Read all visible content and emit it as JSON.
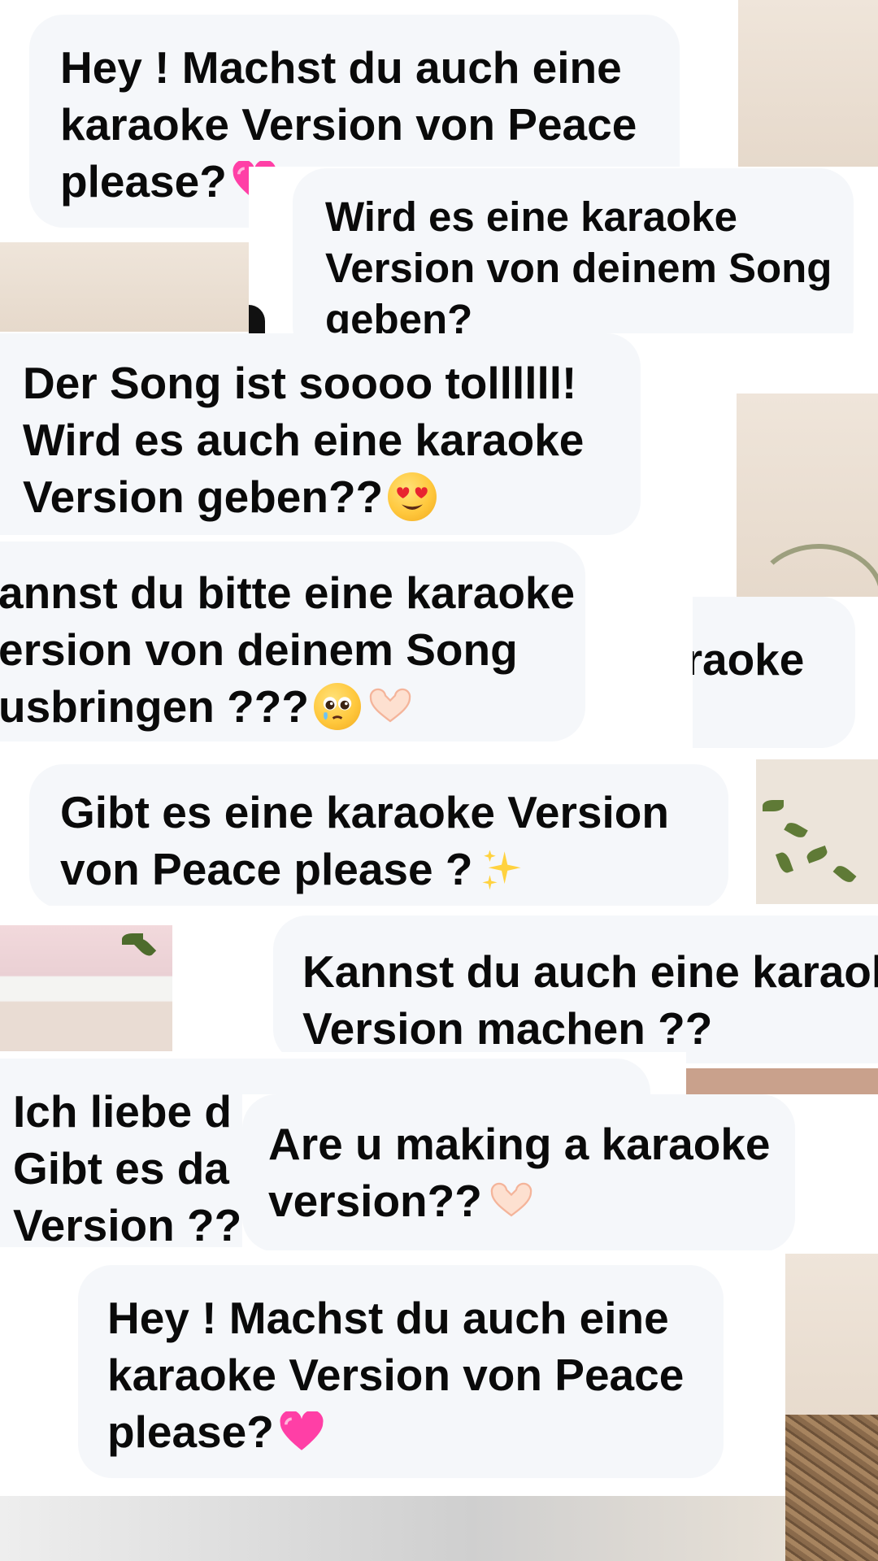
{
  "messages": {
    "msg1": {
      "lines": [
        "Hey ! Machst du auch eine",
        "karaoke Version von Peace",
        "please?"
      ],
      "emoji": "heart-icon"
    },
    "msg2": {
      "lines": [
        "Wird es eine karaoke",
        "Version von deinem Song",
        "geben?"
      ]
    },
    "msg3": {
      "lines": [
        "Der Song ist soooo tollllll!",
        "Wird es auch eine karaoke",
        "Version geben??"
      ],
      "emoji": "heart-eyes-icon"
    },
    "msg4": {
      "lines": [
        "annst du bitte eine karaoke",
        "ersion von deinem Song",
        "usbringen ???"
      ],
      "emoji": [
        "pleading-icon",
        "hands-heart-icon"
      ]
    },
    "msg4b": {
      "lines": [
        "araoke"
      ]
    },
    "msg5": {
      "lines": [
        "Gibt es eine karaoke Version",
        "von Peace please ?"
      ],
      "emoji": "sparkles-icon"
    },
    "msg6": {
      "lines": [
        "Kannst du auch eine karaoke",
        "Version machen ??"
      ]
    },
    "msg7": {
      "lines": [
        "Ich liebe d",
        "Gibt es da",
        "Version ??"
      ]
    },
    "msg8": {
      "lines": [
        "Are u making a karaoke",
        "version??"
      ],
      "emoji": "hands-heart-icon"
    },
    "msg9": {
      "lines": [
        "Hey ! Machst du auch eine",
        "karaoke Version von Peace",
        "please?"
      ],
      "emoji": "heart-icon"
    }
  },
  "colors": {
    "bubble": "#f5f7fa",
    "text": "#0a0a0a",
    "heart": "#ff3fa6"
  }
}
